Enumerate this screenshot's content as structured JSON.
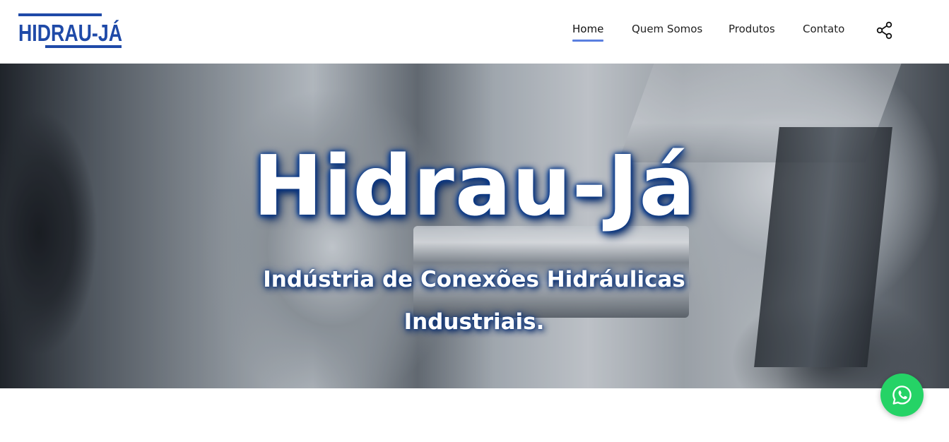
{
  "brand": {
    "logo_text": "HIDRAU-JÁ",
    "logo_color": "#1f4aa8"
  },
  "nav": {
    "items": [
      {
        "label": "Home",
        "active": true
      },
      {
        "label": "Quem Somos",
        "active": false
      },
      {
        "label": "Produtos",
        "active": false
      },
      {
        "label": "Contato",
        "active": false
      }
    ],
    "active_underline_color": "#5a7fe0",
    "share_icon": "share-icon"
  },
  "hero": {
    "title": "Hidrau-Já",
    "subtitle_line1": "Indústria de Conexões Hidráulicas",
    "subtitle_line2": "Industriais.",
    "title_glow_color": "#0b3a8a",
    "background": "lathe machining photo"
  },
  "floating": {
    "whatsapp_icon": "whatsapp-icon",
    "whatsapp_color": "#25d366"
  }
}
